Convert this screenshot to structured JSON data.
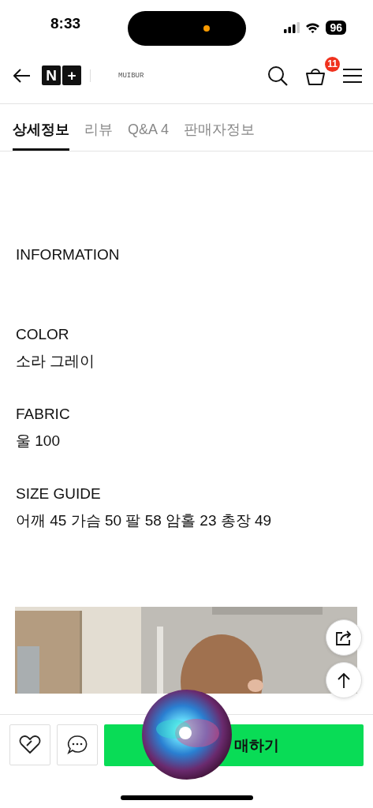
{
  "status_bar": {
    "time": "8:33",
    "battery": "96"
  },
  "header": {
    "logo": [
      "N",
      "+"
    ],
    "brand": "MUIBUR",
    "cart_count": "11"
  },
  "tabs": [
    {
      "label": "상세정보",
      "selected": true
    },
    {
      "label": "리뷰",
      "selected": false
    },
    {
      "label": "Q&A 4",
      "selected": false
    },
    {
      "label": "판매자정보",
      "selected": false
    }
  ],
  "sections": [
    {
      "heading": "INFORMATION"
    },
    {
      "heading": "COLOR",
      "value": "소라 그레이"
    },
    {
      "heading": "FABRIC",
      "value": "울 100"
    },
    {
      "heading": "SIZE GUIDE",
      "value": "어깨 45 가슴 50 팔 58 암홀 23 총장 49"
    }
  ],
  "bottom_bar": {
    "buy_label": "매하기"
  }
}
